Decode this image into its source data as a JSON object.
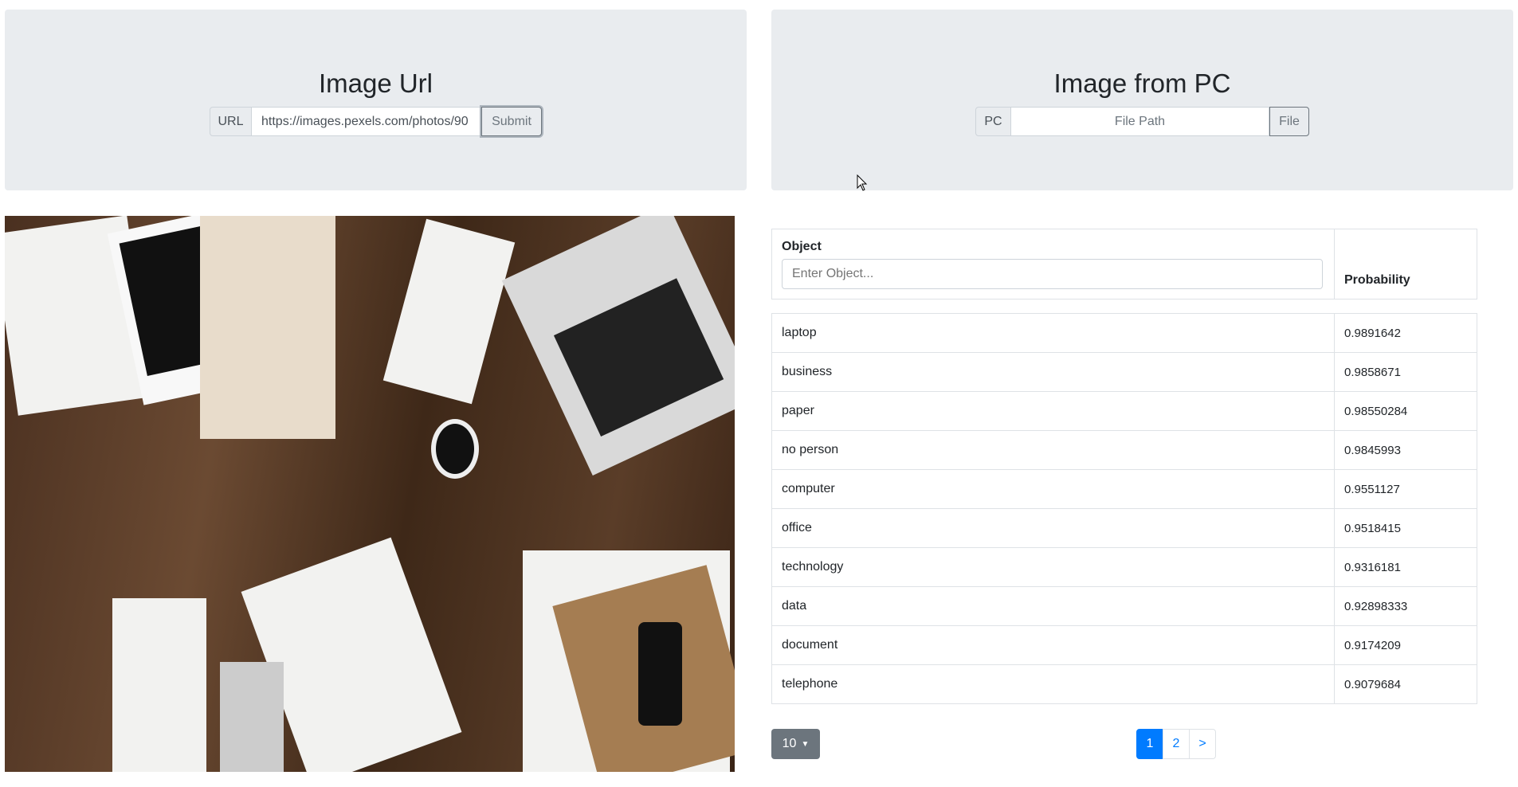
{
  "url_panel": {
    "title": "Image Url",
    "prefix": "URL",
    "value": "https://images.pexels.com/photos/90",
    "submit": "Submit"
  },
  "pc_panel": {
    "title": "Image from PC",
    "prefix": "PC",
    "placeholder": "File Path",
    "file": "File"
  },
  "table": {
    "col_object": "Object",
    "filter_placeholder": "Enter Object...",
    "col_probability": "Probability",
    "rows": [
      {
        "object": "laptop",
        "probability": "0.9891642"
      },
      {
        "object": "business",
        "probability": "0.9858671"
      },
      {
        "object": "paper",
        "probability": "0.98550284"
      },
      {
        "object": "no person",
        "probability": "0.9845993"
      },
      {
        "object": "computer",
        "probability": "0.9551127"
      },
      {
        "object": "office",
        "probability": "0.9518415"
      },
      {
        "object": "technology",
        "probability": "0.9316181"
      },
      {
        "object": "data",
        "probability": "0.92898333"
      },
      {
        "object": "document",
        "probability": "0.9174209"
      },
      {
        "object": "telephone",
        "probability": "0.9079684"
      }
    ]
  },
  "page_size": "10",
  "pagination": [
    "1",
    "2",
    ">"
  ],
  "accent": "#007bff"
}
